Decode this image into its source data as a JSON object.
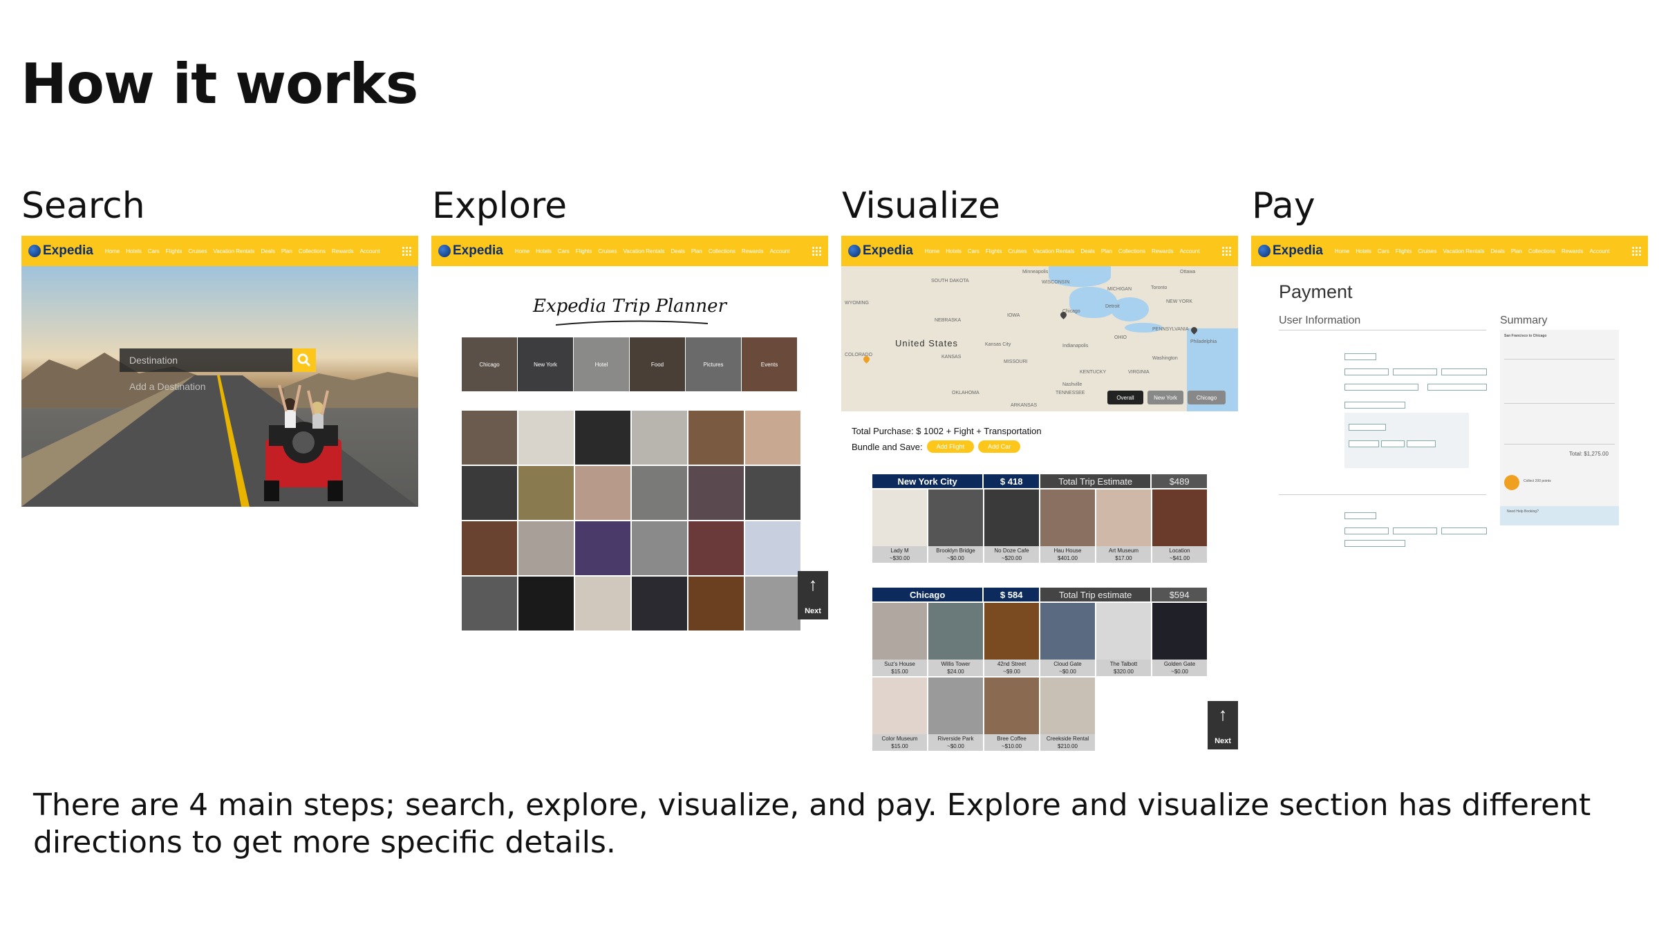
{
  "title": "How it works",
  "steps": {
    "search": "Search",
    "explore": "Explore",
    "visualize": "Visualize",
    "pay": "Pay"
  },
  "nav": {
    "brand": "Expedia",
    "links": [
      "Home",
      "Hotels",
      "Cars",
      "Flights",
      "Cruises",
      "Vacation Rentals",
      "Deals",
      "Plan",
      "Collections",
      "Rewards",
      "Account"
    ]
  },
  "search_panel": {
    "destination_placeholder": "Destination",
    "add_destination": "Add a Destination"
  },
  "explore_panel": {
    "planner_title": "Expedia Trip Planner",
    "categories": [
      "Chicago",
      "New York",
      "Hotel",
      "Food",
      "Pictures",
      "Events"
    ],
    "next": "Next"
  },
  "visualize_panel": {
    "map_labels": {
      "country": "United States",
      "places": [
        "Minneapolis",
        "SOUTH DAKOTA",
        "WISCONSIN",
        "MICHIGAN",
        "Toronto",
        "Ottawa",
        "Chicago",
        "Detroit",
        "NEW YORK",
        "NEBRASKA",
        "IOWA",
        "OHIO",
        "PENNSYLVANIA",
        "Kansas City",
        "Indianapolis",
        "KANSAS",
        "MISSOURI",
        "KENTUCKY",
        "Washington",
        "Philadelphia",
        "OKLAHOMA",
        "ARKANSAS",
        "TENNESSEE",
        "Nashville",
        "VIRGINIA",
        "WYOMING",
        "COLORADO"
      ]
    },
    "map_buttons": [
      "Overall",
      "New York",
      "Chicago"
    ],
    "total_purchase": "Total Purchase: $ 1002 + Fight + Transportation",
    "bundle_label": "Bundle and Save:",
    "add_flight": "Add Flight",
    "add_car": "Add Car",
    "trips": [
      {
        "city": "New York City",
        "price": "$ 418",
        "total_label": "Total Trip Estimate",
        "total": "$489",
        "items": [
          {
            "name": "Lady M",
            "cost": "~$30.00"
          },
          {
            "name": "Brooklyn Bridge",
            "cost": "~$0.00"
          },
          {
            "name": "No Doze Cafe",
            "cost": "~$20.00"
          },
          {
            "name": "Hau House",
            "cost": "$401.00"
          },
          {
            "name": "Art Museum",
            "cost": "$17.00"
          },
          {
            "name": "Location",
            "cost": "~$41.00"
          }
        ]
      },
      {
        "city": "Chicago",
        "price": "$ 584",
        "total_label": "Total Trip estimate",
        "total": "$594",
        "items": [
          {
            "name": "Suz's House",
            "cost": "$15.00"
          },
          {
            "name": "Willis Tower",
            "cost": "$24.00"
          },
          {
            "name": "42nd Street",
            "cost": "~$9.00"
          },
          {
            "name": "Cloud Gate",
            "cost": "~$0.00"
          },
          {
            "name": "The Talbott",
            "cost": "$320.00"
          },
          {
            "name": "Golden Gate",
            "cost": "~$0.00"
          },
          {
            "name": "Color Museum",
            "cost": "$15.00"
          },
          {
            "name": "Riverside Park",
            "cost": "~$0.00"
          },
          {
            "name": "Bree Coffee",
            "cost": "~$10.00"
          },
          {
            "name": "Creekside Rental",
            "cost": "$210.00"
          }
        ]
      }
    ],
    "next": "Next"
  },
  "pay_panel": {
    "title": "Payment",
    "user_info": "User Information",
    "summary": "Summary",
    "trip_route": "San Francisco to Chicago",
    "total": "Total: $1,275.00",
    "points": "Collect 200 points",
    "booking": "Need Help Booking?"
  },
  "footer": "There are 4 main steps; search, explore, visualize, and pay. Explore and visualize section has different directions to get more specific details.",
  "colors": {
    "brand_yellow": "#fdc61a",
    "brand_navy": "#0c2b5c"
  }
}
